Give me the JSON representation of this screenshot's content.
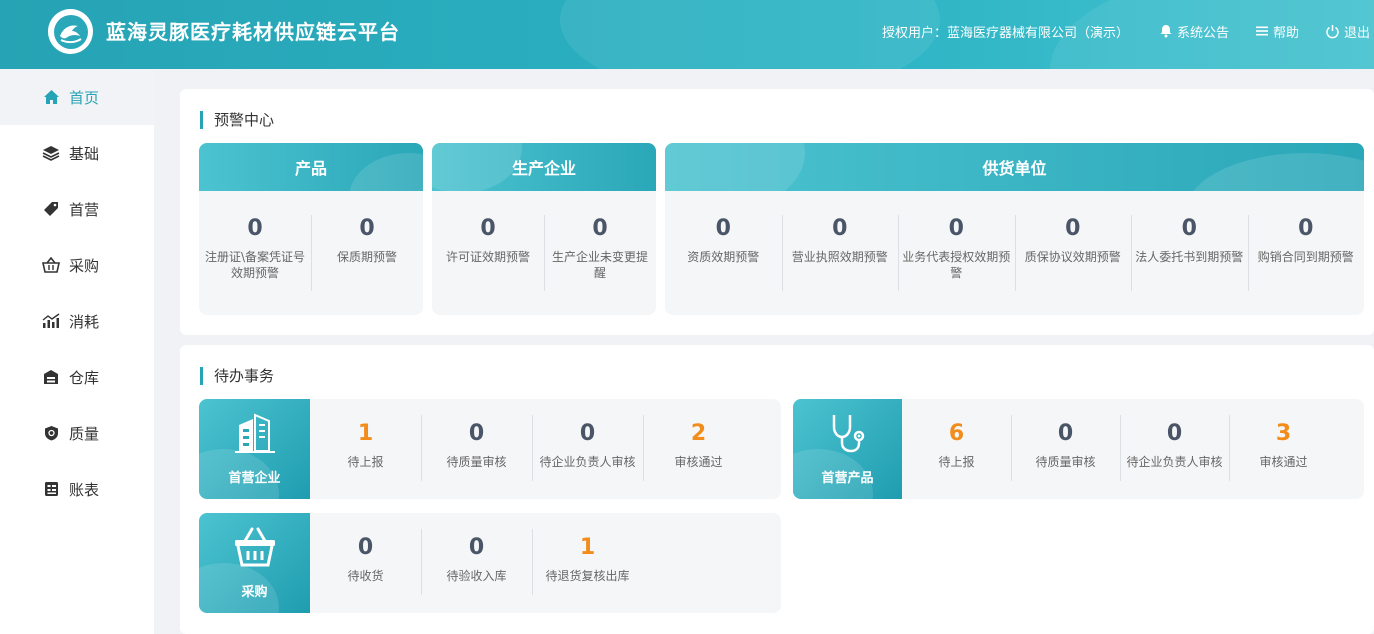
{
  "header": {
    "app_title": "蓝海灵豚医疗耗材供应链云平台",
    "user_label": "授权用户：蓝海医疗器械有限公司（演示）",
    "notice": "系统公告",
    "help": "帮助",
    "logout": "退出"
  },
  "sidebar": {
    "items": [
      {
        "label": "首页",
        "icon": "home-icon"
      },
      {
        "label": "基础",
        "icon": "layers-icon"
      },
      {
        "label": "首营",
        "icon": "tag-icon"
      },
      {
        "label": "采购",
        "icon": "basket-icon"
      },
      {
        "label": "消耗",
        "icon": "chart-icon"
      },
      {
        "label": "仓库",
        "icon": "warehouse-icon"
      },
      {
        "label": "质量",
        "icon": "shield-icon"
      },
      {
        "label": "账表",
        "icon": "report-icon"
      }
    ]
  },
  "warning": {
    "title": "预警中心",
    "product": {
      "title": "产品",
      "items": [
        {
          "value": "0",
          "label": "注册证\\备案凭证号效期预警"
        },
        {
          "value": "0",
          "label": "保质期预警"
        }
      ]
    },
    "manufacturer": {
      "title": "生产企业",
      "items": [
        {
          "value": "0",
          "label": "许可证效期预警"
        },
        {
          "value": "0",
          "label": "生产企业未变更提醒"
        }
      ]
    },
    "supplier": {
      "title": "供货单位",
      "items": [
        {
          "value": "0",
          "label": "资质效期预警"
        },
        {
          "value": "0",
          "label": "营业执照效期预警"
        },
        {
          "value": "0",
          "label": "业务代表授权效期预警"
        },
        {
          "value": "0",
          "label": "质保协议效期预警"
        },
        {
          "value": "0",
          "label": "法人委托书到期预警"
        },
        {
          "value": "0",
          "label": "购销合同到期预警"
        }
      ]
    }
  },
  "todo": {
    "title": "待办事务",
    "first_enterprise": {
      "name": "首营企业",
      "items": [
        {
          "value": "1",
          "label": "待上报"
        },
        {
          "value": "0",
          "label": "待质量审核"
        },
        {
          "value": "0",
          "label": "待企业负责人审核"
        },
        {
          "value": "2",
          "label": "审核通过"
        }
      ]
    },
    "first_product": {
      "name": "首营产品",
      "items": [
        {
          "value": "6",
          "label": "待上报"
        },
        {
          "value": "0",
          "label": "待质量审核"
        },
        {
          "value": "0",
          "label": "待企业负责人审核"
        },
        {
          "value": "3",
          "label": "审核通过"
        }
      ]
    },
    "purchase": {
      "name": "采购",
      "items": [
        {
          "value": "0",
          "label": "待收货"
        },
        {
          "value": "0",
          "label": "待验收入库"
        },
        {
          "value": "1",
          "label": "待退货复核出库"
        }
      ]
    }
  },
  "colors": {
    "accent": "#26a3b4",
    "highlight": "#f28c1b",
    "number": "#4a5568"
  }
}
